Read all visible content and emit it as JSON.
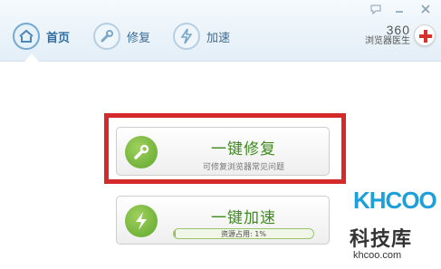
{
  "header": {
    "tabs": [
      {
        "label": "首页",
        "icon": "home-icon",
        "active": true
      },
      {
        "label": "修复",
        "icon": "wrench-icon",
        "active": false
      },
      {
        "label": "加速",
        "icon": "lightning-icon",
        "active": false
      }
    ],
    "brand": {
      "number": "360",
      "name": "浏览器医生",
      "logo": "red-cross-icon"
    },
    "window_controls": [
      "feedback-icon",
      "minimize-icon",
      "close-icon"
    ]
  },
  "actions": {
    "repair": {
      "title": "一键修复",
      "subtitle": "可修复浏览器常见问题",
      "icon": "wrench-icon"
    },
    "speed": {
      "title": "一键加速",
      "progress_text": "资源占用: 1%",
      "progress_value": 0.01,
      "icon": "lightning-icon"
    }
  },
  "watermark": {
    "brand": "KHCOO",
    "chinese": "科技库",
    "url": "khcoo.com"
  },
  "colors": {
    "accent_green": "#5fa72c",
    "title_green": "#3f8a1f",
    "highlight_red": "#d42a2a",
    "header_blue": "#2f6ea3",
    "watermark_blue": "#1d9fd8"
  }
}
